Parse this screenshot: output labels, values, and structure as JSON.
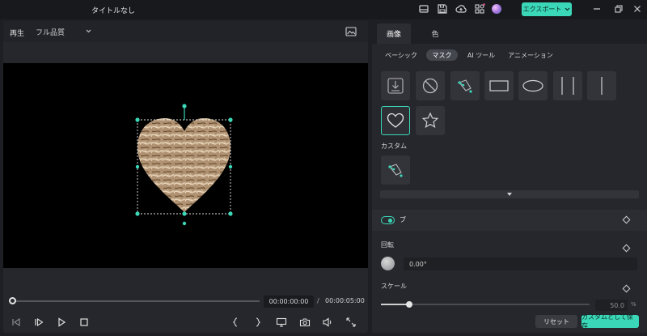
{
  "app": {
    "title": "タイトルなし",
    "export_label": "エクスポート"
  },
  "colors": {
    "accent": "#3ad8b8",
    "bg": "#1e1f24",
    "panel": "#26272c",
    "canvas": "#000000"
  },
  "icons": [
    "layout-icon",
    "save-icon",
    "cloud-upload-icon",
    "apps-icon",
    "avatar",
    "chevron-down-icon",
    "minimize-icon",
    "restore-icon",
    "close-icon",
    "snapshot-icon",
    "heart-icon",
    "star-icon",
    "pen-icon",
    "import-icon",
    "none-icon",
    "rectangle-icon",
    "ellipse-icon",
    "single-line-icon",
    "double-line-icon",
    "keyframe-icon"
  ],
  "player": {
    "play_label": "再生",
    "quality": "フル品質",
    "current_time": "00:00:00:00",
    "separator": "/",
    "total_time": "00:00:05:00",
    "progress": 0
  },
  "panel": {
    "tabs": [
      {
        "label": "画像"
      },
      {
        "label": "色"
      }
    ],
    "subtabs": [
      {
        "label": "ベーシック"
      },
      {
        "label": "マスク"
      },
      {
        "label": "AI ツール"
      },
      {
        "label": "アニメーション"
      }
    ],
    "custom_label": "カスタム",
    "feather_label": "ブ",
    "rotate": {
      "label": "回転",
      "value": "0.00°"
    },
    "scale": {
      "label": "スケール",
      "value": "50.0",
      "unit": "%",
      "level": 0.5
    },
    "reset_label": "リセット",
    "save_custom_label": "カスタムとして保存"
  }
}
